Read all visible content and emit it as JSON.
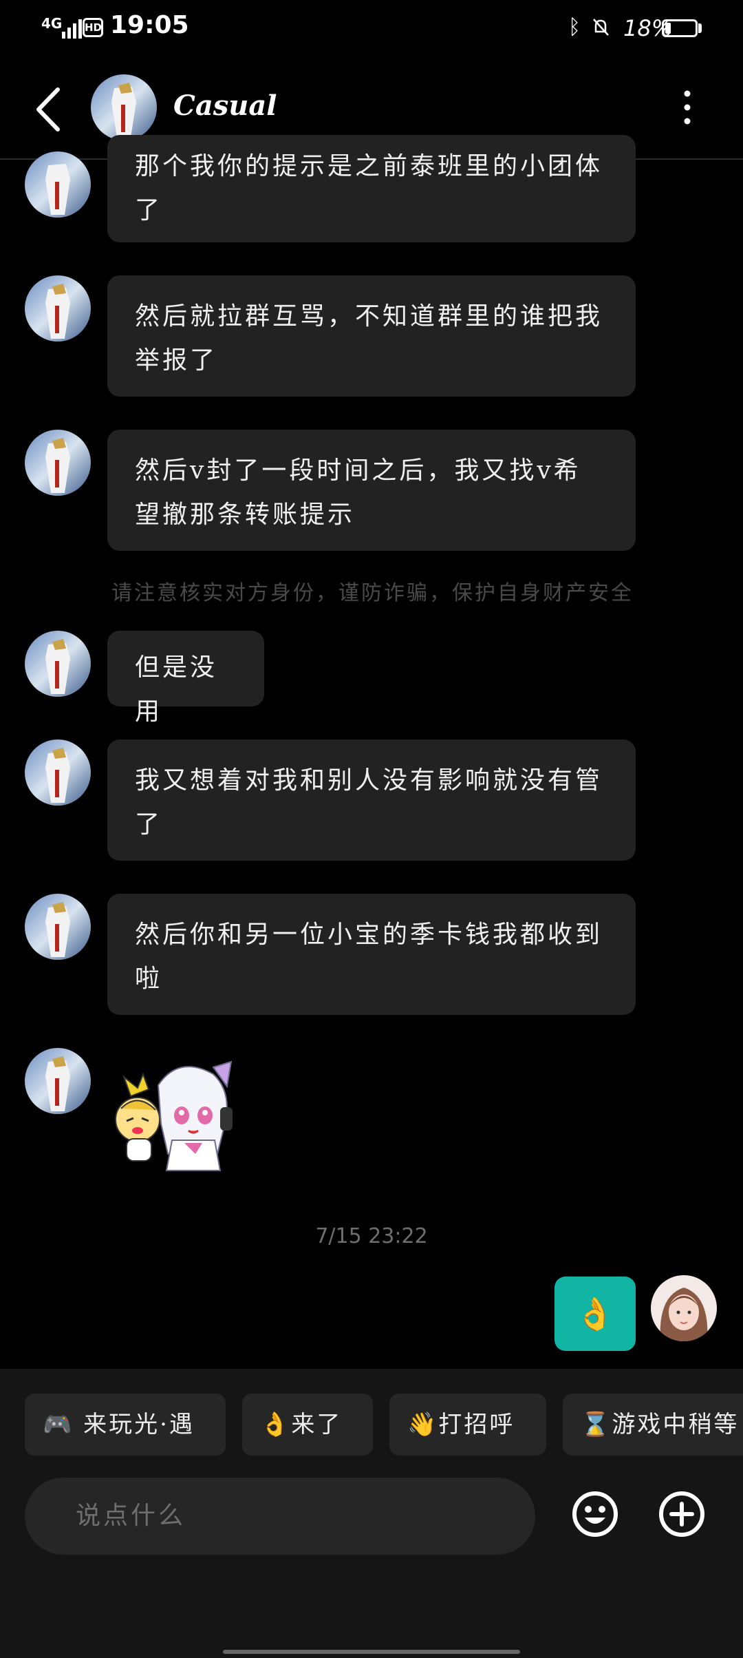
{
  "status_bar": {
    "network": "4G",
    "hd": "HD",
    "time": "19:05",
    "battery": "18%",
    "battery_level": 0.18
  },
  "header": {
    "title": "Casual"
  },
  "messages": [
    {
      "text": "那个我你的提示是之前泰班里的小团体了"
    },
    {
      "text": "然后就拉群互骂，不知道群里的谁把我举报了"
    },
    {
      "text": "然后v封了一段时间之后，我又找v希望撤那条转账提示"
    },
    {
      "text": "但是没用"
    },
    {
      "text": "我又想着对我和别人没有影响就没有管了"
    },
    {
      "text": "然后你和另一位小宝的季卡钱我都收到啦"
    }
  ],
  "warning": "请注意核实对方身份，谨防诈骗，保护自身财产安全",
  "timestamp": "7/15  23:22",
  "sent_message": "👌",
  "quick_replies": [
    {
      "label": "🎮 来玩光·遇"
    },
    {
      "label": "👌来了"
    },
    {
      "label": "👋打招呼"
    },
    {
      "label": "⌛游戏中稍等"
    }
  ],
  "input": {
    "placeholder": "说点什么"
  },
  "icons": {
    "back": "back-arrow-icon",
    "more": "more-vertical-icon",
    "emoji": "smiley-icon",
    "plus": "plus-circle-icon"
  },
  "colors": {
    "background": "#000000",
    "bubble": "#222222",
    "accent": "#12b5a4"
  }
}
